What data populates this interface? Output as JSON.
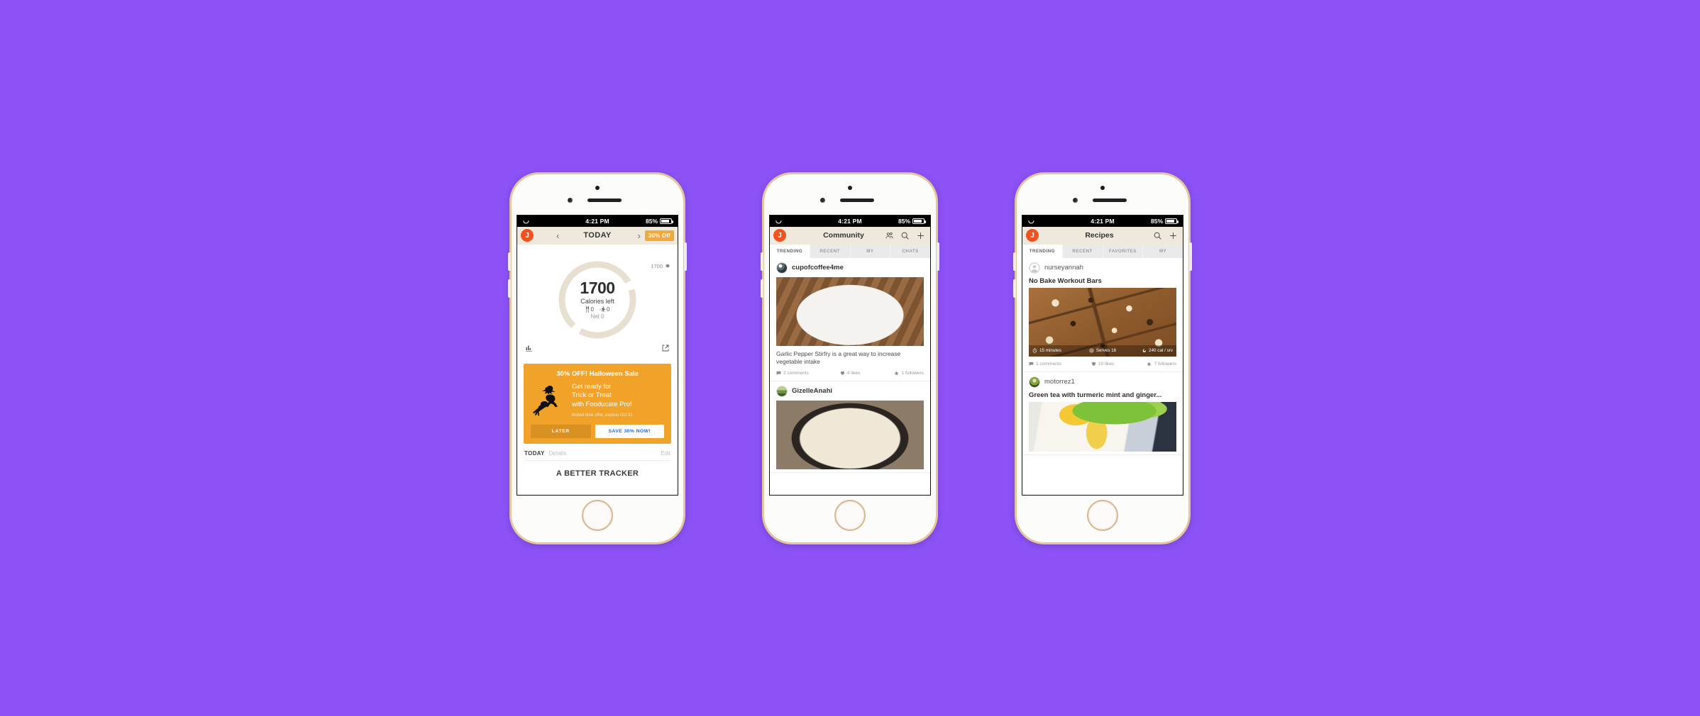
{
  "background_color": "#8C52F6",
  "status_bar": {
    "time": "4:21 PM",
    "battery_percent": "85%",
    "wifi_icon": "wifi-icon"
  },
  "phone1": {
    "nav": {
      "avatar_initial": "J",
      "prev_icon": "chevron-left-icon",
      "title": "TODAY",
      "next_icon": "chevron-right-icon",
      "promo_badge": "30% Off"
    },
    "calories": {
      "goal_value": "1700",
      "gear_icon": "gear-icon",
      "big_number": "1700",
      "subtitle": "Calories left",
      "food_icon": "cutlery-icon",
      "food_value": "0",
      "exercise_icon": "runner-icon",
      "exercise_value": "0",
      "net": "Net 0",
      "ring_color": "#E7E0D0",
      "chart_icon": "bar-chart-icon",
      "share_icon": "share-icon"
    },
    "promo": {
      "bg_color": "#F0A229",
      "title": "30% OFF! Halloween Sale",
      "witch_icon": "witch-on-broom-icon",
      "line1": "Get ready for",
      "line2": "Trick or Treat",
      "line3": "with Fooducate Pro!",
      "fine_print": "limited time offer, expires Oct 31",
      "later_label": "LATER",
      "save_label": "SAVE 30% NOW!",
      "save_text_color": "#1F6FD0"
    },
    "today_section": {
      "label": "TODAY",
      "details": "Details",
      "edit": "Edit"
    },
    "tracker_heading": "A BETTER TRACKER"
  },
  "phone2": {
    "nav": {
      "avatar_initial": "J",
      "title": "Community",
      "friends_icon": "people-icon",
      "search_icon": "search-icon",
      "add_icon": "plus-icon"
    },
    "tabs": [
      {
        "label": "TRENDING",
        "active": true
      },
      {
        "label": "RECENT",
        "active": false
      },
      {
        "label": "MY",
        "active": false
      },
      {
        "label": "CHATS",
        "active": false
      }
    ],
    "posts": [
      {
        "username": "cupofcoffee4me",
        "avatar_icon": "user-photo-avatar",
        "photo_alt": "stir-fry-vegetable-bowl-photo",
        "caption": "Garlic Pepper Stirfry is a great way to increase vegetable intake",
        "comments": "2 comments",
        "likes": "4 likes",
        "followers": "1 followers"
      },
      {
        "username": "GizelleAnahi",
        "avatar_icon": "user-photo-avatar",
        "photo_alt": "noodle-soup-bowl-photo",
        "caption": "",
        "comments": "",
        "likes": "",
        "followers": ""
      }
    ]
  },
  "phone3": {
    "nav": {
      "avatar_initial": "J",
      "title": "Recipes",
      "search_icon": "search-icon",
      "add_icon": "plus-icon"
    },
    "tabs": [
      {
        "label": "TRENDING",
        "active": true
      },
      {
        "label": "RECENT",
        "active": false
      },
      {
        "label": "FAVORITES",
        "active": false
      },
      {
        "label": "MY",
        "active": false
      }
    ],
    "recipes": [
      {
        "username": "nurseyannah",
        "avatar_icon": "default-user-avatar",
        "title": "No Bake Workout Bars",
        "photo_alt": "granola-bars-photo",
        "time_icon": "clock-icon",
        "time": "15 minutes",
        "serves_icon": "plate-icon",
        "serves": "Serves 16",
        "cal_icon": "flame-icon",
        "calories": "240 cal / srv",
        "comments": "1 comments",
        "likes": "10 likes",
        "followers": "7 followers"
      },
      {
        "username": "motorrez1",
        "avatar_icon": "user-photo-avatar",
        "title": "Green tea with turmeric mint and ginger...",
        "photo_alt": "green-tea-mint-jar-photo",
        "time": "",
        "serves": "",
        "calories": "",
        "comments": "",
        "likes": "",
        "followers": ""
      }
    ]
  }
}
